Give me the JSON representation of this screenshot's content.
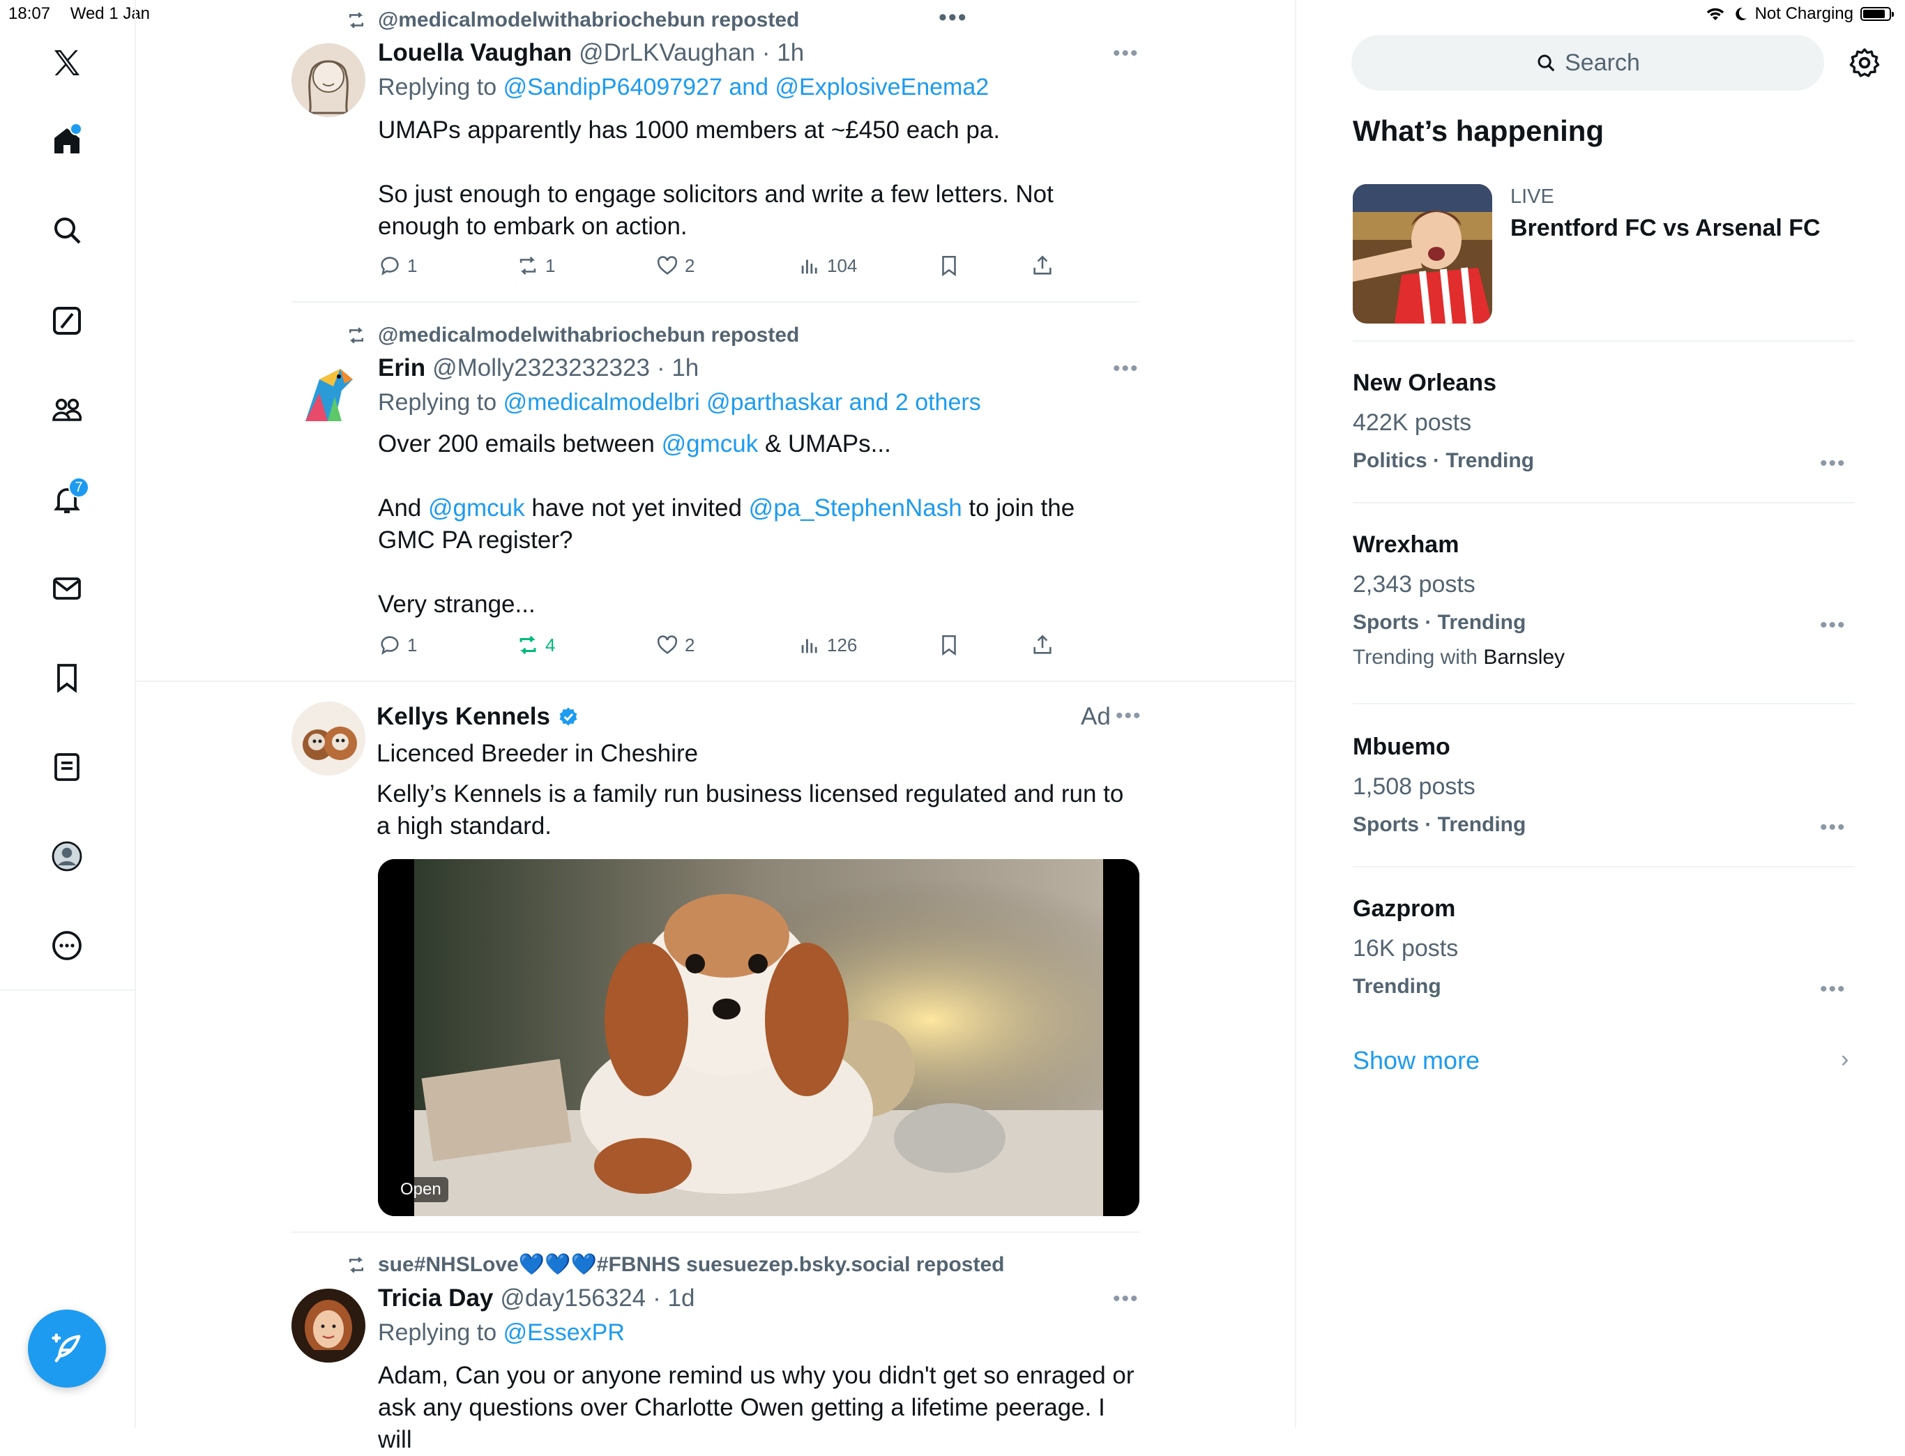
{
  "status_bar": {
    "time": "18:07",
    "date": "Wed 1 Jan",
    "battery_text": "Not Charging"
  },
  "nav": {
    "notifications_badge": "7",
    "icons": [
      "x-logo-icon",
      "home-icon",
      "search-icon",
      "grok-icon",
      "communities-icon",
      "notifications-icon",
      "messages-icon",
      "bookmarks-icon",
      "lists-icon",
      "profile-icon",
      "more-icon"
    ]
  },
  "feed": {
    "top_more": "•••",
    "posts": [
      {
        "repost_by": "@medicalmodelwithabriochebun reposted",
        "name": "Louella Vaughan",
        "handle": "@DrLKVaughan",
        "time": "· 1h",
        "replying_prefix": "Replying to",
        "replying_to": "@SandipP64097927 and @ExplosiveEnema2",
        "text1": "UMAPs apparently has 1000 members at ~£450 each pa.",
        "text2": "So just enough to engage solicitors and write a few letters. Not enough to embark on action.",
        "replies": "1",
        "reposts": "1",
        "likes": "2",
        "views": "104"
      },
      {
        "repost_by": "@medicalmodelwithabriochebun reposted",
        "name": "Erin",
        "handle": "@Molly2323232323",
        "time": "· 1h",
        "replying_prefix": "Replying to",
        "replying_to": "@medicalmodelbri @parthaskar and 2 others",
        "l1a": "Over 200 emails between ",
        "l1b": "@gmcuk",
        "l1c": " & UMAPs...",
        "l2a": "And ",
        "l2b": "@gmcuk",
        "l2c": " have not yet invited ",
        "l2d": "@pa_StephenNash",
        "l2e": " to join the GMC PA register?",
        "l3": "Very strange...",
        "replies": "1",
        "reposts": "4",
        "likes": "2",
        "views": "126"
      }
    ],
    "ad": {
      "name": "Kellys Kennels",
      "ad_label": "Ad",
      "subtitle": "Licenced Breeder in Cheshire",
      "text": "Kelly’s Kennels is a family run business licensed regulated and run to a high standard.",
      "open_label": "Open"
    },
    "last_post": {
      "repost_by": "sue#NHSLove💙💙💙#FBNHS suesuezep.bsky.social reposted",
      "name": "Tricia Day",
      "handle": "@day156324",
      "time": "· 1d",
      "replying_prefix": "Replying to",
      "replying_to": "@EssexPR",
      "text": "Adam, Can you or anyone remind us why you didn't get so enraged or ask any questions over Charlotte Owen getting a lifetime peerage. I will"
    }
  },
  "sidebar": {
    "search_placeholder": "Search",
    "whats_happening": "What’s happening",
    "live_label": "LIVE",
    "live_title": "Brentford FC vs Arsenal FC",
    "trends": [
      {
        "name": "New Orleans",
        "count": "422K posts",
        "category": "Politics · Trending"
      },
      {
        "name": "Wrexham",
        "count": "2,343 posts",
        "category": "Sports · Trending",
        "with_prefix": "Trending with",
        "with_name": "Barnsley"
      },
      {
        "name": "Mbuemo",
        "count": "1,508 posts",
        "category": "Sports · Trending"
      },
      {
        "name": "Gazprom",
        "count": "16K posts",
        "category": "Trending"
      }
    ],
    "show_more": "Show more"
  },
  "colors": {
    "accent": "#1d9bf0",
    "repost_green": "#00ba7c",
    "secondary_text": "#536471",
    "divider": "#eff3f4"
  }
}
